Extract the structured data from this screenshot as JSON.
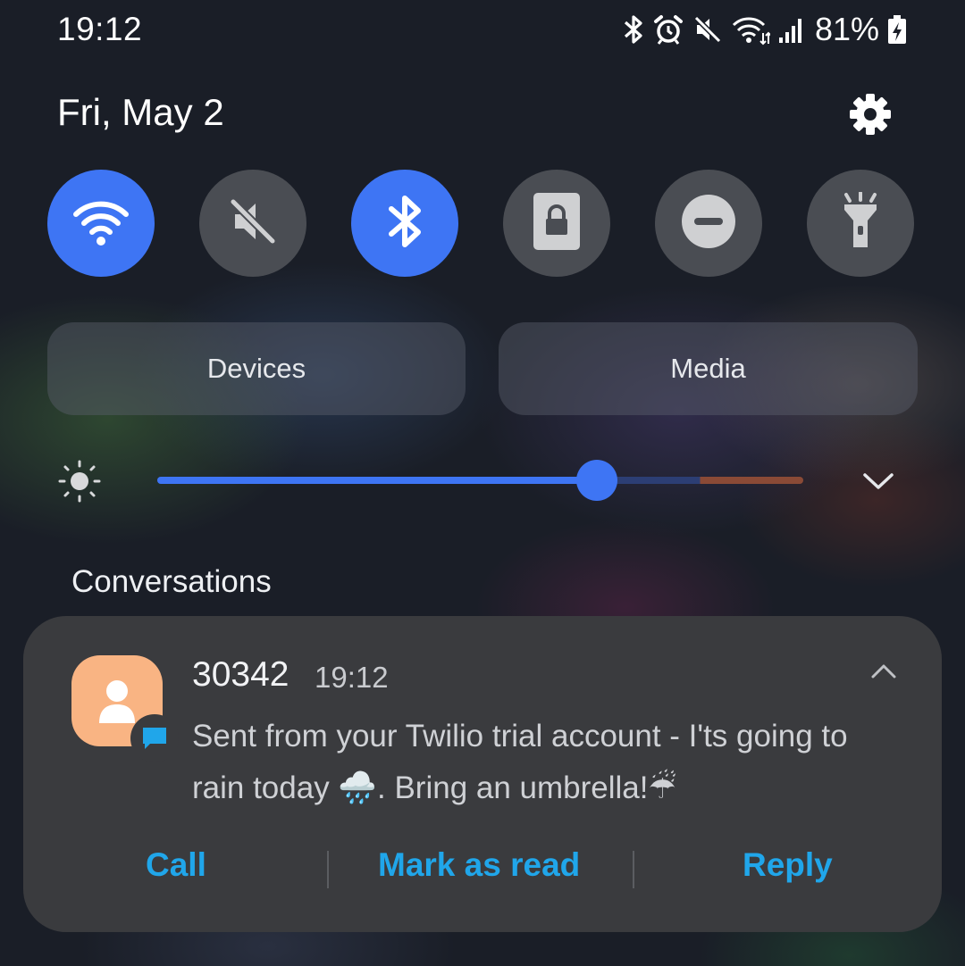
{
  "status_bar": {
    "time": "19:12",
    "battery_percent": "81%",
    "icons": [
      "bluetooth-icon",
      "alarm-icon",
      "mute-icon",
      "wifi-icon",
      "signal-icon",
      "battery-charging-icon"
    ]
  },
  "header": {
    "date": "Fri, May 2",
    "settings_icon": "gear-icon"
  },
  "quick_settings": [
    {
      "name": "wifi",
      "icon": "wifi-icon",
      "active": true
    },
    {
      "name": "sound",
      "icon": "mute-icon",
      "active": false
    },
    {
      "name": "bluetooth",
      "icon": "bluetooth-icon",
      "active": true
    },
    {
      "name": "screen-lock",
      "icon": "lock-icon",
      "active": false
    },
    {
      "name": "do-not-disturb",
      "icon": "minus-circle-icon",
      "active": false
    },
    {
      "name": "flashlight",
      "icon": "flashlight-icon",
      "active": false
    }
  ],
  "buttons": {
    "devices": "Devices",
    "media": "Media"
  },
  "brightness": {
    "level": 0.68
  },
  "conversations": {
    "section_label": "Conversations",
    "notification": {
      "sender": "30342",
      "time": "19:12",
      "message": "Sent from your Twilio trial account - I'ts going to rain today 🌧️. Bring an umbrella!☔",
      "actions": {
        "call": "Call",
        "mark_read": "Mark as read",
        "reply": "Reply"
      }
    }
  },
  "colors": {
    "accent": "#3e75f4",
    "action_text": "#20a6ea",
    "tile_off": "#4a4d53",
    "card": "#3a3b3e",
    "avatar": "#f9b483"
  }
}
